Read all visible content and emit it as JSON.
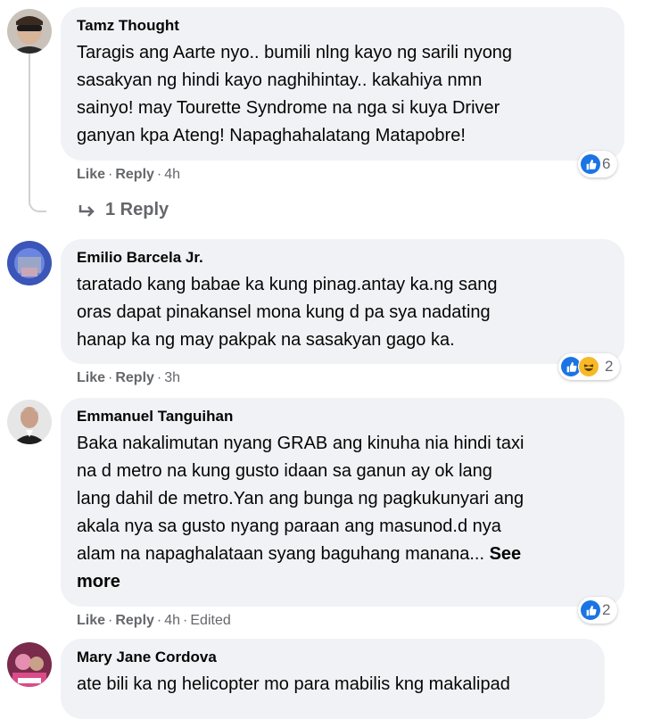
{
  "comments": [
    {
      "author": "Tamz Thought",
      "text_lines": [
        "Taragis ang Aarte nyo.. bumili nlng kayo ng sarili nyong",
        "sasakyan ng hindi kayo naghihintay.. kakahiya nmn",
        "sainyo! may Tourette Syndrome na nga si kuya Driver",
        "ganyan kpa Ateng! Napaghahalatang Matapobre!"
      ],
      "like_label": "Like",
      "reply_label": "Reply",
      "time": "4h",
      "reaction_count": "6",
      "reactions": [
        "like-icon"
      ],
      "replies_label": "1 Reply"
    },
    {
      "author": "Emilio Barcela Jr.",
      "text_lines": [
        "taratado kang babae ka kung pinag.antay ka.ng sang",
        "oras dapat pinakansel mona kung d pa sya nadating",
        "hanap ka ng may pakpak na sasakyan gago ka."
      ],
      "like_label": "Like",
      "reply_label": "Reply",
      "time": "3h",
      "reaction_count": "2",
      "reactions": [
        "like-icon",
        "haha-icon"
      ]
    },
    {
      "author": "Emmanuel Tanguihan",
      "text_lines": [
        "Baka nakalimutan nyang GRAB ang kinuha nia hindi taxi",
        "na d metro na kung gusto idaan sa ganun ay ok lang",
        "lang dahil de metro.Yan ang bunga ng pagkukunyari ang",
        "akala nya sa gusto nyang paraan ang masunod.d nya",
        "alam na napaghalataan syang baguhang manana..."
      ],
      "see_more": "See more",
      "see_more_first": "See",
      "see_more_second": "more",
      "like_label": "Like",
      "reply_label": "Reply",
      "time": "4h",
      "edited": "Edited",
      "reaction_count": "2",
      "reactions": [
        "like-icon"
      ]
    },
    {
      "author": "Mary Jane Cordova",
      "text_lines": [
        "ate bili ka ng helicopter mo para mabilis kng makalipad"
      ]
    }
  ],
  "separator": "·",
  "colors": {
    "bubble": "#f0f2f5",
    "meta_text": "#65676b",
    "like_blue": "#1b74e4",
    "haha_yellow": "#f7b928"
  }
}
